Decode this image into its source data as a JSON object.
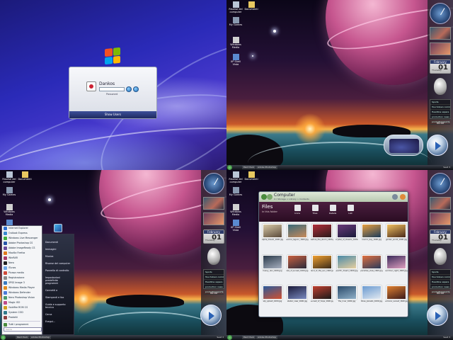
{
  "login": {
    "user_name": "Dankos",
    "password_placeholder": "",
    "password_hint": "Password",
    "switch_user_label": "Show Users"
  },
  "desktop": {
    "icons": [
      {
        "label": "Risorse del computer"
      },
      {
        "label": "Documenti"
      },
      {
        "label": "My Games"
      },
      {
        "label": "Windows Media"
      },
      {
        "label": "XP Shell Vista"
      }
    ]
  },
  "sidebar": {
    "calendar_month": "February",
    "calendar_day": "01",
    "calendar_weekday": "Thursday",
    "feed_title": "Sports",
    "feed_items": [
      "Touchdown comment",
      "Headline sapere",
      "production news",
      "productionsports"
    ],
    "media_time": "00:00"
  },
  "taskbar": {
    "items": [
      "Start",
      "Paint Pack",
      "Adobe Photoshop"
    ],
    "clock": "Seat 3"
  },
  "start_menu": {
    "left_items": [
      {
        "label": "Internet Explorer",
        "color": "#2f6fd0"
      },
      {
        "label": "Outlook Express",
        "color": "#3a8ad0"
      },
      {
        "label": "Windows Live Messenger",
        "color": "#3fae3f"
      },
      {
        "label": "Adobe Photoshop CS",
        "color": "#2855a8"
      },
      {
        "label": "Adobe ImageReady CS",
        "color": "#6a4c9c"
      },
      {
        "label": "Mozilla Firefox",
        "color": "#e07a1e"
      },
      {
        "label": "WinRAR",
        "color": "#a83a6a"
      },
      {
        "label": "Nero",
        "color": "#222222"
      },
      {
        "label": "iTunes",
        "color": "#6fa6e6"
      },
      {
        "label": "Picasa media",
        "color": "#d04a3a"
      },
      {
        "label": "Registrazione",
        "color": "#8a8a8a"
      },
      {
        "label": "SPSS Image 3",
        "color": "#3a7ac0"
      },
      {
        "label": "Windows Media Player",
        "color": "#e38b1f"
      },
      {
        "label": "Windows Defender",
        "color": "#4a7ad8"
      },
      {
        "label": "Nero Photoshop Vision",
        "color": "#4a9a6a"
      },
      {
        "label": "Magic ISO",
        "color": "#c04a8a"
      },
      {
        "label": "Goldfire ROM CS",
        "color": "#d0a020"
      },
      {
        "label": "System COD",
        "color": "#307a8a"
      },
      {
        "label": "Prodotti",
        "color": "#904040"
      }
    ],
    "all_programs": "Tutti i programmi",
    "search_placeholder": "Cerca",
    "right_items": [
      "Documenti",
      "Immagini",
      "Musica",
      "Risorse del computer",
      "Pannello di controllo",
      "Impostazioni predefinite programmi",
      "Connetti a",
      "Stampanti e fax",
      "Guida e supporto tecnico",
      "Cerca",
      "Esegui..."
    ]
  },
  "explorer": {
    "title": "Computer",
    "breadcrumb": "C:\\ Storage  >  Library  >  Contents",
    "banner_title": "Files",
    "banner_subtitle": "in this folder",
    "toolbar": [
      "Icons",
      "Tiles",
      "Details",
      "List"
    ],
    "files": [
      {
        "name": "Alpha_Dream_1600.jpg",
        "c1": "#d8c9a8",
        "c2": "#5a4a3a"
      },
      {
        "name": "aurora_lagoon_1600.jpg",
        "c1": "#3a6a7a",
        "c2": "#c88a5a"
      },
      {
        "name": "before_the_storm_1600.jpg",
        "c1": "#b02e3a",
        "c2": "#2a1a1a"
      },
      {
        "name": "crystal_of_dreams_1600.jpg",
        "c1": "#6a3a7a",
        "c2": "#1a1a3a"
      },
      {
        "name": "cosmic_bay_1600.jpg",
        "c1": "#e8a040",
        "c2": "#1a3a5a"
      },
      {
        "name": "golden_world_1600.jpg",
        "c1": "#f0c060",
        "c2": "#4a2a1a"
      },
      {
        "name": "heavy_rain_1600.jpg",
        "c1": "#2a3a4a",
        "c2": "#a8b0c0"
      },
      {
        "name": "isle_of_sunset_1600.jpg",
        "c1": "#c86040",
        "c2": "#2a2a3a"
      },
      {
        "name": "land_of_the_sun_1600.jpg",
        "c1": "#f0a030",
        "c2": "#3a2a1a"
      },
      {
        "name": "pacific_dream_1600.jpg",
        "c1": "#4a8aa8",
        "c2": "#e8d0a0"
      },
      {
        "name": "paradise_view_1600.jpg",
        "c1": "#e07040",
        "c2": "#2a3a5a"
      },
      {
        "name": "summer_night_1600.jpg",
        "c1": "#3a2a5a",
        "c2": "#e0a0c0"
      },
      {
        "name": "sky_splash_1600.jpg",
        "c1": "#2a5a9a",
        "c2": "#d05030"
      },
      {
        "name": "stellar_view_1600.jpg",
        "c1": "#1a1a3a",
        "c2": "#7a8ac0"
      },
      {
        "name": "sunset_of_hope_1600.jpg",
        "c1": "#c04030",
        "c2": "#1a1a1a"
      },
      {
        "name": "the_river_1600.jpg",
        "c1": "#2a4a6a",
        "c2": "#90b0c8"
      },
      {
        "name": "three_planets_1600.jpg",
        "c1": "#6a9ad0",
        "c2": "#e0e8f0"
      },
      {
        "name": "volcano_sunset_1600.jpg",
        "c1": "#e08030",
        "c2": "#3a1a1a"
      }
    ]
  },
  "colors": {
    "login_accent": "#2a2ab8",
    "planet": "#c6568f",
    "start_menu_dark": "#1e2230"
  }
}
